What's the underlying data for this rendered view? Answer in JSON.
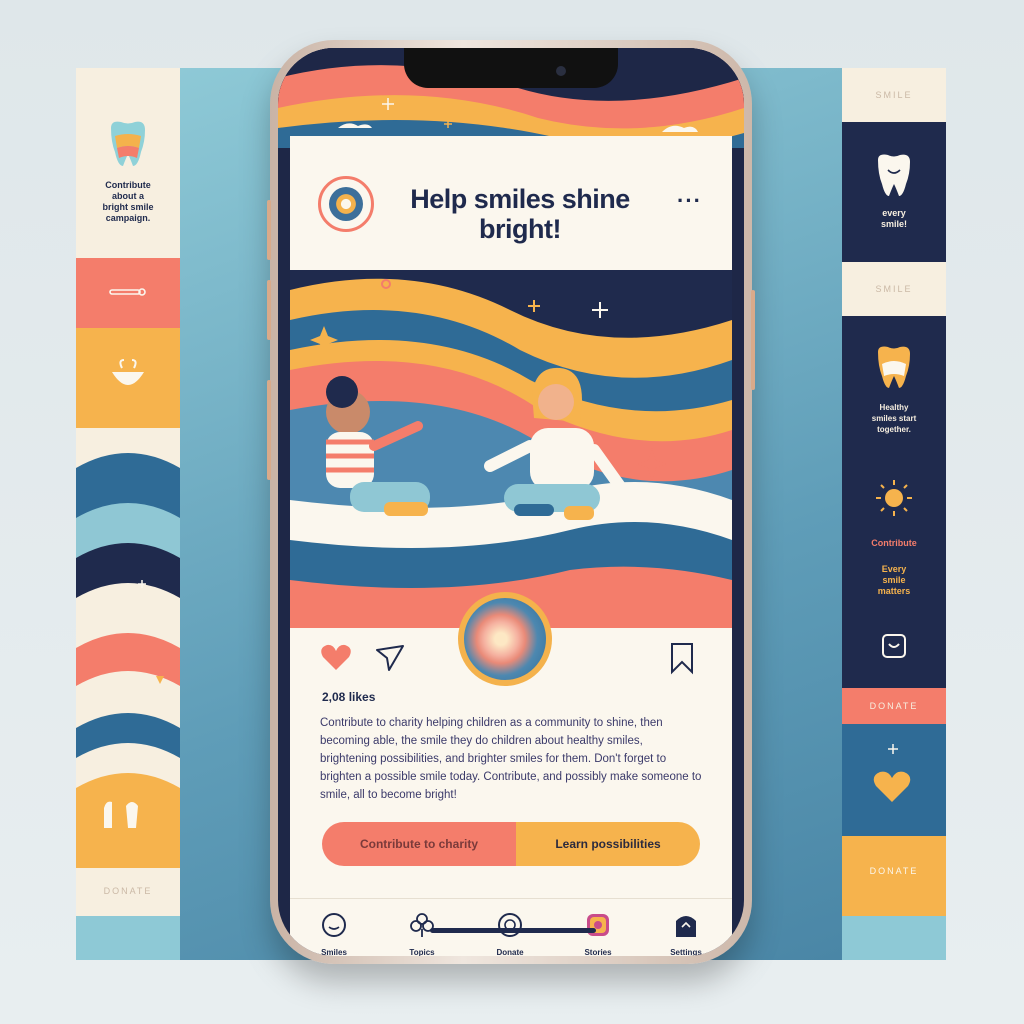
{
  "left_panel": {
    "intro_text": "Contribute\nabout a\nbright smile\ncampaign.",
    "footer_label": "DONATE"
  },
  "right_panel": {
    "top_label": "SMILE",
    "section1_text": "every\nsmile!",
    "section2_label": "SMILE",
    "section3_text": "Healthy\nsmiles start\ntogether.",
    "contribute_label": "Contribute",
    "contribute_sub": "Every\nsmile\nmatters",
    "donate_label": "DONATE",
    "bottom_label": "DONATE"
  },
  "post": {
    "headline": "Help smiles shine bright!",
    "more_icon": "more-icon",
    "likes": "2,08 likes",
    "caption": "Contribute to charity helping children as a community to shine, then becoming able, the smile they do children about healthy smiles, brightening possibilities, and brighter smiles for them. Don't forget to brighten a possible smile today. Contribute, and possibly make someone to smile, all to become bright!",
    "cta_primary": "Contribute to charity",
    "cta_secondary": "Learn possibilities"
  },
  "tabs": [
    {
      "label": "Smiles",
      "icon": "smile-icon"
    },
    {
      "label": "Topics",
      "icon": "clover-icon"
    },
    {
      "label": "Donate",
      "icon": "donate-icon"
    },
    {
      "label": "Stories",
      "icon": "instagram-icon"
    },
    {
      "label": "Settings",
      "icon": "home-icon"
    }
  ],
  "colors": {
    "navy": "#1f2a4d",
    "coral": "#f47d6b",
    "amber": "#f6b34d",
    "cream": "#fbf7ee",
    "teal": "#4d88b0"
  }
}
